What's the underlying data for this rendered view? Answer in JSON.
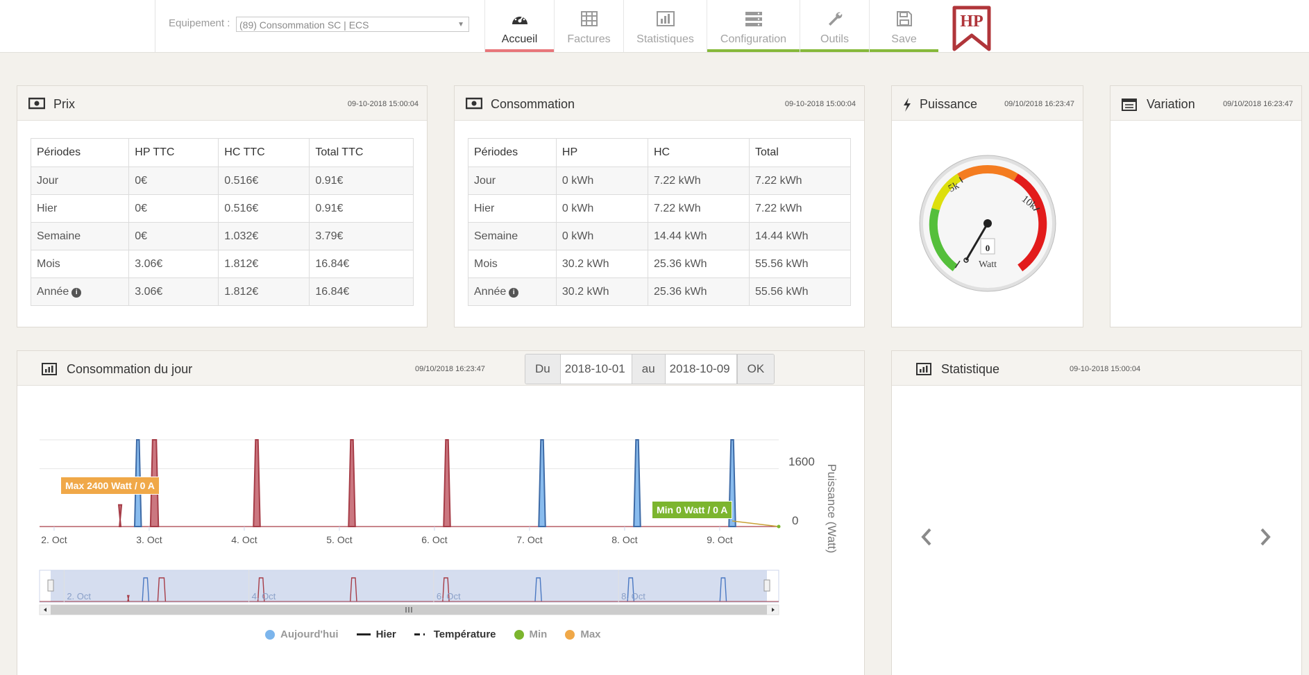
{
  "header": {
    "equip_label": "Equipement :",
    "equip_value": "(89) Consommation SC | ECS",
    "logo_text": "HP",
    "nav": [
      {
        "label": "Accueil",
        "icon": "dashboard-icon",
        "active": true,
        "bar_color": "#e8767a"
      },
      {
        "label": "Factures",
        "icon": "table-icon",
        "active": false,
        "bar_color": ""
      },
      {
        "label": "Statistiques",
        "icon": "bar-chart-icon",
        "active": false,
        "bar_color": ""
      },
      {
        "label": "Configuration",
        "icon": "server-icon",
        "active": false,
        "bar_color": "#86b93a"
      },
      {
        "label": "Outils",
        "icon": "wrench-icon",
        "active": false,
        "bar_color": "#86b93a"
      },
      {
        "label": "Save",
        "icon": "save-icon",
        "active": false,
        "bar_color": "#86b93a"
      }
    ]
  },
  "prix": {
    "title": "Prix",
    "timestamp": "09-10-2018 15:00:04",
    "headers": [
      "Périodes",
      "HP TTC",
      "HC TTC",
      "Total TTC"
    ],
    "rows": [
      [
        "Jour",
        "0€",
        "0.516€",
        "0.91€"
      ],
      [
        "Hier",
        "0€",
        "0.516€",
        "0.91€"
      ],
      [
        "Semaine",
        "0€",
        "1.032€",
        "3.79€"
      ],
      [
        "Mois",
        "3.06€",
        "1.812€",
        "16.84€"
      ],
      [
        "Année",
        "3.06€",
        "1.812€",
        "16.84€"
      ]
    ]
  },
  "consommation": {
    "title": "Consommation",
    "timestamp": "09-10-2018 15:00:04",
    "headers": [
      "Périodes",
      "HP",
      "HC",
      "Total"
    ],
    "rows": [
      [
        "Jour",
        "0 kWh",
        "7.22 kWh",
        "7.22 kWh"
      ],
      [
        "Hier",
        "0 kWh",
        "7.22 kWh",
        "7.22 kWh"
      ],
      [
        "Semaine",
        "0 kWh",
        "14.44 kWh",
        "14.44 kWh"
      ],
      [
        "Mois",
        "30.2 kWh",
        "25.36 kWh",
        "55.56 kWh"
      ],
      [
        "Année",
        "30.2 kWh",
        "25.36 kWh",
        "55.56 kWh"
      ]
    ]
  },
  "puissance": {
    "title": "Puissance",
    "timestamp": "09/10/2018 16:23:47",
    "gauge_value": "0",
    "gauge_unit": "Watt",
    "tick_5k": "5k",
    "tick_10k": "10k"
  },
  "variation": {
    "title": "Variation",
    "timestamp": "09/10/2018 16:23:47"
  },
  "daily": {
    "title": "Consommation du jour",
    "timestamp": "09/10/2018 16:23:47",
    "du_label": "Du",
    "du_value": "2018-10-01",
    "au_label": "au",
    "au_value": "2018-10-09",
    "ok_label": "OK"
  },
  "statistique": {
    "title": "Statistique",
    "timestamp": "09-10-2018 15:00:04"
  },
  "chart_data": {
    "type": "area",
    "x_ticks": [
      "2. Oct",
      "3. Oct",
      "4. Oct",
      "5. Oct",
      "6. Oct",
      "7. Oct",
      "8. Oct",
      "9. Oct"
    ],
    "y_ticks": [
      "0",
      "1600"
    ],
    "ylabel": "Puissance (Watt)",
    "ylim": [
      0,
      2400
    ],
    "grid": true,
    "legend_position": "bottom",
    "annotations": {
      "max_label": "Max 2400 Watt / 0 A",
      "min_label": "Min 0 Watt / 0 A"
    },
    "navigator_ticks": [
      "2. Oct",
      "4. Oct",
      "6. Oct",
      "8. Oct"
    ],
    "series": [
      {
        "name": "Aujourd'hui",
        "color": "#7cb5ec",
        "pulses": [
          {
            "start": "2018-10-02 20:20",
            "end": "2018-10-02 22:00",
            "value": 2400
          },
          {
            "start": "2018-10-07 02:20",
            "end": "2018-10-07 04:00",
            "value": 2400
          },
          {
            "start": "2018-10-08 02:20",
            "end": "2018-10-08 04:00",
            "value": 2400
          },
          {
            "start": "2018-10-09 02:20",
            "end": "2018-10-09 04:00",
            "value": 2400
          }
        ]
      },
      {
        "name": "Hier",
        "color": "#b94a55",
        "pulses": [
          {
            "start": "2018-10-02 16:30",
            "end": "2018-10-02 16:50",
            "value": 600
          },
          {
            "start": "2018-10-03 00:20",
            "end": "2018-10-03 02:20",
            "value": 2400
          },
          {
            "start": "2018-10-04 02:20",
            "end": "2018-10-04 04:00",
            "value": 2400
          },
          {
            "start": "2018-10-05 02:20",
            "end": "2018-10-05 04:00",
            "value": 2400
          },
          {
            "start": "2018-10-06 02:20",
            "end": "2018-10-06 04:00",
            "value": 2400
          }
        ]
      },
      {
        "name": "Température",
        "color": "#333333",
        "pulses": []
      },
      {
        "name": "Min",
        "color": "#7cb52e",
        "pulses": []
      },
      {
        "name": "Max",
        "color": "#f0a848",
        "pulses": []
      }
    ]
  }
}
